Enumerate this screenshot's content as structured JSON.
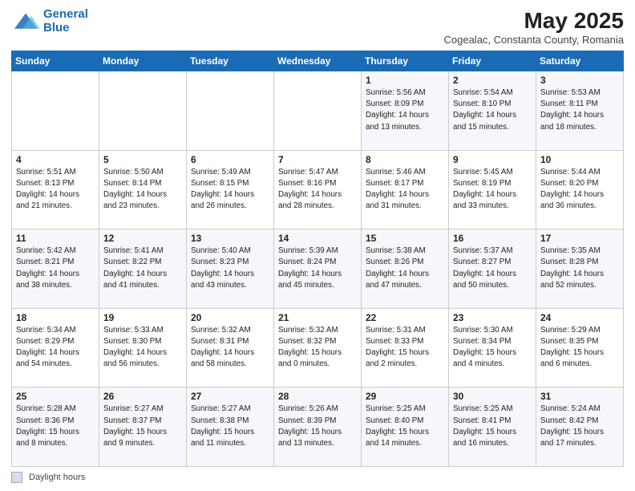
{
  "header": {
    "logo_line1": "General",
    "logo_line2": "Blue",
    "main_title": "May 2025",
    "subtitle": "Cogealac, Constanta County, Romania"
  },
  "calendar": {
    "days_of_week": [
      "Sunday",
      "Monday",
      "Tuesday",
      "Wednesday",
      "Thursday",
      "Friday",
      "Saturday"
    ],
    "weeks": [
      [
        {
          "day": "",
          "info": ""
        },
        {
          "day": "",
          "info": ""
        },
        {
          "day": "",
          "info": ""
        },
        {
          "day": "",
          "info": ""
        },
        {
          "day": "1",
          "info": "Sunrise: 5:56 AM\nSunset: 8:09 PM\nDaylight: 14 hours\nand 13 minutes."
        },
        {
          "day": "2",
          "info": "Sunrise: 5:54 AM\nSunset: 8:10 PM\nDaylight: 14 hours\nand 15 minutes."
        },
        {
          "day": "3",
          "info": "Sunrise: 5:53 AM\nSunset: 8:11 PM\nDaylight: 14 hours\nand 18 minutes."
        }
      ],
      [
        {
          "day": "4",
          "info": "Sunrise: 5:51 AM\nSunset: 8:13 PM\nDaylight: 14 hours\nand 21 minutes."
        },
        {
          "day": "5",
          "info": "Sunrise: 5:50 AM\nSunset: 8:14 PM\nDaylight: 14 hours\nand 23 minutes."
        },
        {
          "day": "6",
          "info": "Sunrise: 5:49 AM\nSunset: 8:15 PM\nDaylight: 14 hours\nand 26 minutes."
        },
        {
          "day": "7",
          "info": "Sunrise: 5:47 AM\nSunset: 8:16 PM\nDaylight: 14 hours\nand 28 minutes."
        },
        {
          "day": "8",
          "info": "Sunrise: 5:46 AM\nSunset: 8:17 PM\nDaylight: 14 hours\nand 31 minutes."
        },
        {
          "day": "9",
          "info": "Sunrise: 5:45 AM\nSunset: 8:19 PM\nDaylight: 14 hours\nand 33 minutes."
        },
        {
          "day": "10",
          "info": "Sunrise: 5:44 AM\nSunset: 8:20 PM\nDaylight: 14 hours\nand 36 minutes."
        }
      ],
      [
        {
          "day": "11",
          "info": "Sunrise: 5:42 AM\nSunset: 8:21 PM\nDaylight: 14 hours\nand 38 minutes."
        },
        {
          "day": "12",
          "info": "Sunrise: 5:41 AM\nSunset: 8:22 PM\nDaylight: 14 hours\nand 41 minutes."
        },
        {
          "day": "13",
          "info": "Sunrise: 5:40 AM\nSunset: 8:23 PM\nDaylight: 14 hours\nand 43 minutes."
        },
        {
          "day": "14",
          "info": "Sunrise: 5:39 AM\nSunset: 8:24 PM\nDaylight: 14 hours\nand 45 minutes."
        },
        {
          "day": "15",
          "info": "Sunrise: 5:38 AM\nSunset: 8:26 PM\nDaylight: 14 hours\nand 47 minutes."
        },
        {
          "day": "16",
          "info": "Sunrise: 5:37 AM\nSunset: 8:27 PM\nDaylight: 14 hours\nand 50 minutes."
        },
        {
          "day": "17",
          "info": "Sunrise: 5:35 AM\nSunset: 8:28 PM\nDaylight: 14 hours\nand 52 minutes."
        }
      ],
      [
        {
          "day": "18",
          "info": "Sunrise: 5:34 AM\nSunset: 8:29 PM\nDaylight: 14 hours\nand 54 minutes."
        },
        {
          "day": "19",
          "info": "Sunrise: 5:33 AM\nSunset: 8:30 PM\nDaylight: 14 hours\nand 56 minutes."
        },
        {
          "day": "20",
          "info": "Sunrise: 5:32 AM\nSunset: 8:31 PM\nDaylight: 14 hours\nand 58 minutes."
        },
        {
          "day": "21",
          "info": "Sunrise: 5:32 AM\nSunset: 8:32 PM\nDaylight: 15 hours\nand 0 minutes."
        },
        {
          "day": "22",
          "info": "Sunrise: 5:31 AM\nSunset: 8:33 PM\nDaylight: 15 hours\nand 2 minutes."
        },
        {
          "day": "23",
          "info": "Sunrise: 5:30 AM\nSunset: 8:34 PM\nDaylight: 15 hours\nand 4 minutes."
        },
        {
          "day": "24",
          "info": "Sunrise: 5:29 AM\nSunset: 8:35 PM\nDaylight: 15 hours\nand 6 minutes."
        }
      ],
      [
        {
          "day": "25",
          "info": "Sunrise: 5:28 AM\nSunset: 8:36 PM\nDaylight: 15 hours\nand 8 minutes."
        },
        {
          "day": "26",
          "info": "Sunrise: 5:27 AM\nSunset: 8:37 PM\nDaylight: 15 hours\nand 9 minutes."
        },
        {
          "day": "27",
          "info": "Sunrise: 5:27 AM\nSunset: 8:38 PM\nDaylight: 15 hours\nand 11 minutes."
        },
        {
          "day": "28",
          "info": "Sunrise: 5:26 AM\nSunset: 8:39 PM\nDaylight: 15 hours\nand 13 minutes."
        },
        {
          "day": "29",
          "info": "Sunrise: 5:25 AM\nSunset: 8:40 PM\nDaylight: 15 hours\nand 14 minutes."
        },
        {
          "day": "30",
          "info": "Sunrise: 5:25 AM\nSunset: 8:41 PM\nDaylight: 15 hours\nand 16 minutes."
        },
        {
          "day": "31",
          "info": "Sunrise: 5:24 AM\nSunset: 8:42 PM\nDaylight: 15 hours\nand 17 minutes."
        }
      ]
    ]
  },
  "footer": {
    "label": "Daylight hours"
  }
}
